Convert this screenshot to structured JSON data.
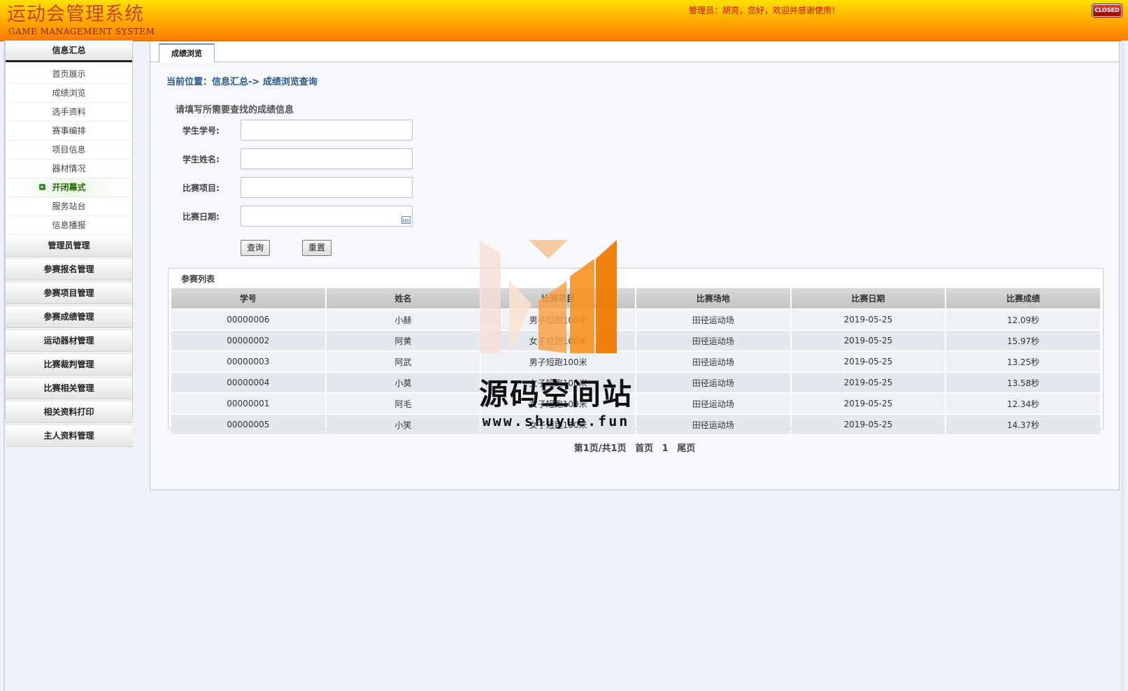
{
  "header": {
    "title": "运动会管理系统",
    "subtitle": "GAME MANAGEMENT SYSTEM",
    "welcome": "管理员：胡亮，您好，欢迎并感谢使用！",
    "close_label": "CLOSED"
  },
  "sidebar": {
    "info_title": "信息汇总",
    "items": [
      {
        "label": "首页展示"
      },
      {
        "label": "成绩浏览"
      },
      {
        "label": "选手资料"
      },
      {
        "label": "赛事编排"
      },
      {
        "label": "项目信息"
      },
      {
        "label": "器材情况"
      },
      {
        "label": "开闭幕式",
        "active": true
      },
      {
        "label": "服务站台"
      },
      {
        "label": "信息播报"
      }
    ],
    "sections": [
      "管理员管理",
      "参赛报名管理",
      "参赛项目管理",
      "参赛成绩管理",
      "运动器材管理",
      "比赛裁判管理",
      "比赛相关管理",
      "相关资料打印",
      "主人资料管理"
    ]
  },
  "main": {
    "tab": "成绩浏览",
    "breadcrumb": "当前位置：信息汇总-> 成绩浏览查询",
    "form_title": "请填写所需要查找的成绩信息",
    "fields": {
      "student_id_label": "学生学号:",
      "student_name_label": "学生姓名:",
      "event_label": "比赛项目:",
      "date_label": "比赛日期:",
      "student_id_value": "",
      "student_name_value": "",
      "event_value": "",
      "date_value": ""
    },
    "query_label": "查询",
    "reset_label": "重置",
    "list": {
      "title": "参赛列表",
      "columns": [
        "学号",
        "姓名",
        "比赛项目",
        "比赛场地",
        "比赛日期",
        "比赛成绩"
      ],
      "rows": [
        [
          "00000006",
          "小赫",
          "男子短跑100米",
          "田径运动场",
          "2019-05-25",
          "12.09秒"
        ],
        [
          "00000002",
          "阿黄",
          "女子短跑100米",
          "田径运动场",
          "2019-05-25",
          "15.97秒"
        ],
        [
          "00000003",
          "阿武",
          "男子短跑100米",
          "田径运动场",
          "2019-05-25",
          "13.25秒"
        ],
        [
          "00000004",
          "小莫",
          "女子短跑100米",
          "田径运动场",
          "2019-05-25",
          "13.58秒"
        ],
        [
          "00000001",
          "阿毛",
          "女子短跑100米",
          "田径运动场",
          "2019-05-25",
          "12.34秒"
        ],
        [
          "00000005",
          "小笑",
          "女子短跑100米",
          "田径运动场",
          "2019-05-25",
          "14.37秒"
        ]
      ]
    },
    "pager": {
      "info": "第1页/共1页",
      "first": "首页",
      "page": "1",
      "last": "尾页"
    }
  },
  "watermark": {
    "text": "源码空间站",
    "url": "www.shuyue.fun"
  },
  "colors": {
    "header_top": "#ffe100",
    "header_bottom": "#ff7a00",
    "title": "#d03a00",
    "welcome": "#d80000",
    "breadcrumb": "#2d5a8a",
    "active_item": "#1a6e00"
  }
}
